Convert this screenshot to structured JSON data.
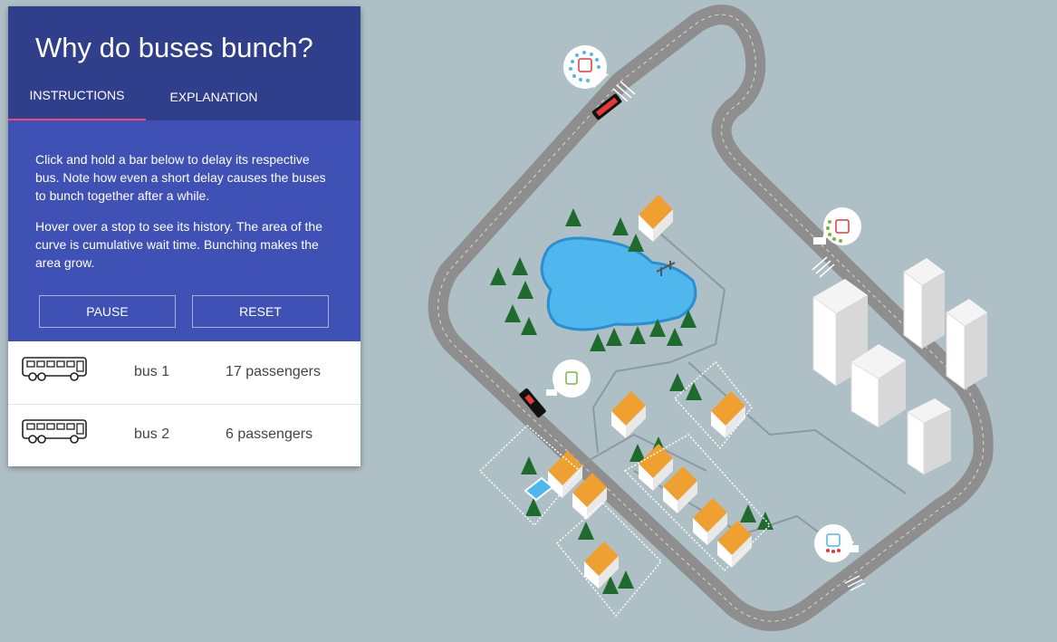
{
  "panel": {
    "title": "Why do buses bunch?",
    "tabs": [
      {
        "label": "INSTRUCTIONS",
        "active": true
      },
      {
        "label": "EXPLANATION",
        "active": false
      }
    ],
    "instructions": [
      "Click and hold a bar below to delay its respective bus. Note how even a short delay causes the buses to bunch together after a while.",
      "Hover over a stop to see its history. The area of the curve is cumulative wait time. Bunching makes the area grow."
    ],
    "buttons": {
      "pause": "PAUSE",
      "reset": "RESET"
    }
  },
  "buses": [
    {
      "name": "bus 1",
      "passengers": "17 passengers",
      "icon": "bus-icon"
    },
    {
      "name": "bus 2",
      "passengers": "6 passengers",
      "icon": "bus-icon"
    }
  ],
  "colors": {
    "header": "#2f3f8c",
    "body": "#3f51b5",
    "tab_indicator": "#ff4081",
    "background": "#aebfc5",
    "road": "#8a8a8a",
    "lake": "#4fb7ee",
    "roof": "#f0a030",
    "tree": "#2e7d32"
  },
  "map": {
    "stops": [
      {
        "name": "stop-icon",
        "waiting_color": "#4fb7ee",
        "bus_color": "#e53935"
      },
      {
        "name": "stop-icon",
        "waiting_color": "#7cb342",
        "bus_color": "#e53935"
      },
      {
        "name": "stop-icon",
        "waiting_color": "#7cb342",
        "bus_color": "#7cb342"
      },
      {
        "name": "stop-icon",
        "waiting_color": "#e53935",
        "bus_color": "#4fb7ee"
      }
    ]
  }
}
